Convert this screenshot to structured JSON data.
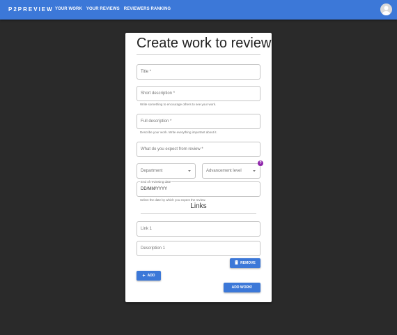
{
  "appbar": {
    "brand": "P2PREVIEW",
    "nav": [
      "YOUR WORK",
      "YOUR REVIEWS",
      "REVIEWERS RANKING"
    ]
  },
  "form": {
    "heading": "Create work to review",
    "title_placeholder": "Title *",
    "short_desc_placeholder": "Short description *",
    "short_desc_helper": "Write something to encourage others to see your work.",
    "full_desc_placeholder": "Full description *",
    "full_desc_helper": "Describe your work. Write everything important about it.",
    "expect_placeholder": "What do you expect from review *",
    "department_label": "Department",
    "advancement_label": "Advancement level",
    "help_badge": "?",
    "date_label": "End of reviewing date",
    "date_value": "DD/MM/YYYY",
    "date_helper": "Select the date by which you expect the review.",
    "links_heading": "Links",
    "link_placeholder": "Link 1",
    "link_desc_placeholder": "Description 1",
    "remove_label": "REMOVE",
    "add_label": "ADD",
    "submit_label": "ADD WORK!"
  },
  "colors": {
    "primary": "#3c78d8",
    "background": "#2a2a2a",
    "help_badge": "#8e24aa"
  },
  "icons": {
    "avatar": "account-circle-icon",
    "remove": "trash-icon",
    "add": "plus-icon",
    "select": "caret-down-icon"
  }
}
